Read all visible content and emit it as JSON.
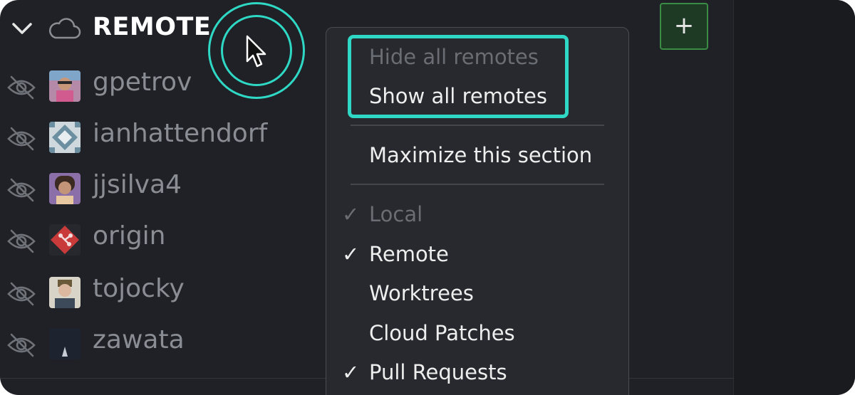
{
  "section": {
    "title": "REMOTE",
    "add_label": "+"
  },
  "remotes": [
    {
      "name": "gpetrov",
      "avatar": "photo-avatar"
    },
    {
      "name": "ianhattendorf",
      "avatar": "pattern-avatar"
    },
    {
      "name": "jjsilva4",
      "avatar": "photo-avatar"
    },
    {
      "name": "origin",
      "avatar": "git-logo-avatar"
    },
    {
      "name": "tojocky",
      "avatar": "photo-avatar"
    },
    {
      "name": "zawata",
      "avatar": "moon-avatar"
    }
  ],
  "menu": {
    "hide_all": "Hide all remotes",
    "show_all": "Show all remotes",
    "maximize": "Maximize this section",
    "check_glyph": "✓",
    "items": [
      {
        "label": "Local",
        "checked": true,
        "disabled": true
      },
      {
        "label": "Remote",
        "checked": true,
        "disabled": false
      },
      {
        "label": "Worktrees",
        "checked": false,
        "disabled": false
      },
      {
        "label": "Cloud Patches",
        "checked": false,
        "disabled": false
      },
      {
        "label": "Pull Requests",
        "checked": true,
        "disabled": false
      }
    ]
  },
  "colors": {
    "background": "#1f2126",
    "highlight": "#2fd8c4",
    "add_button_border": "#3a8c45"
  }
}
